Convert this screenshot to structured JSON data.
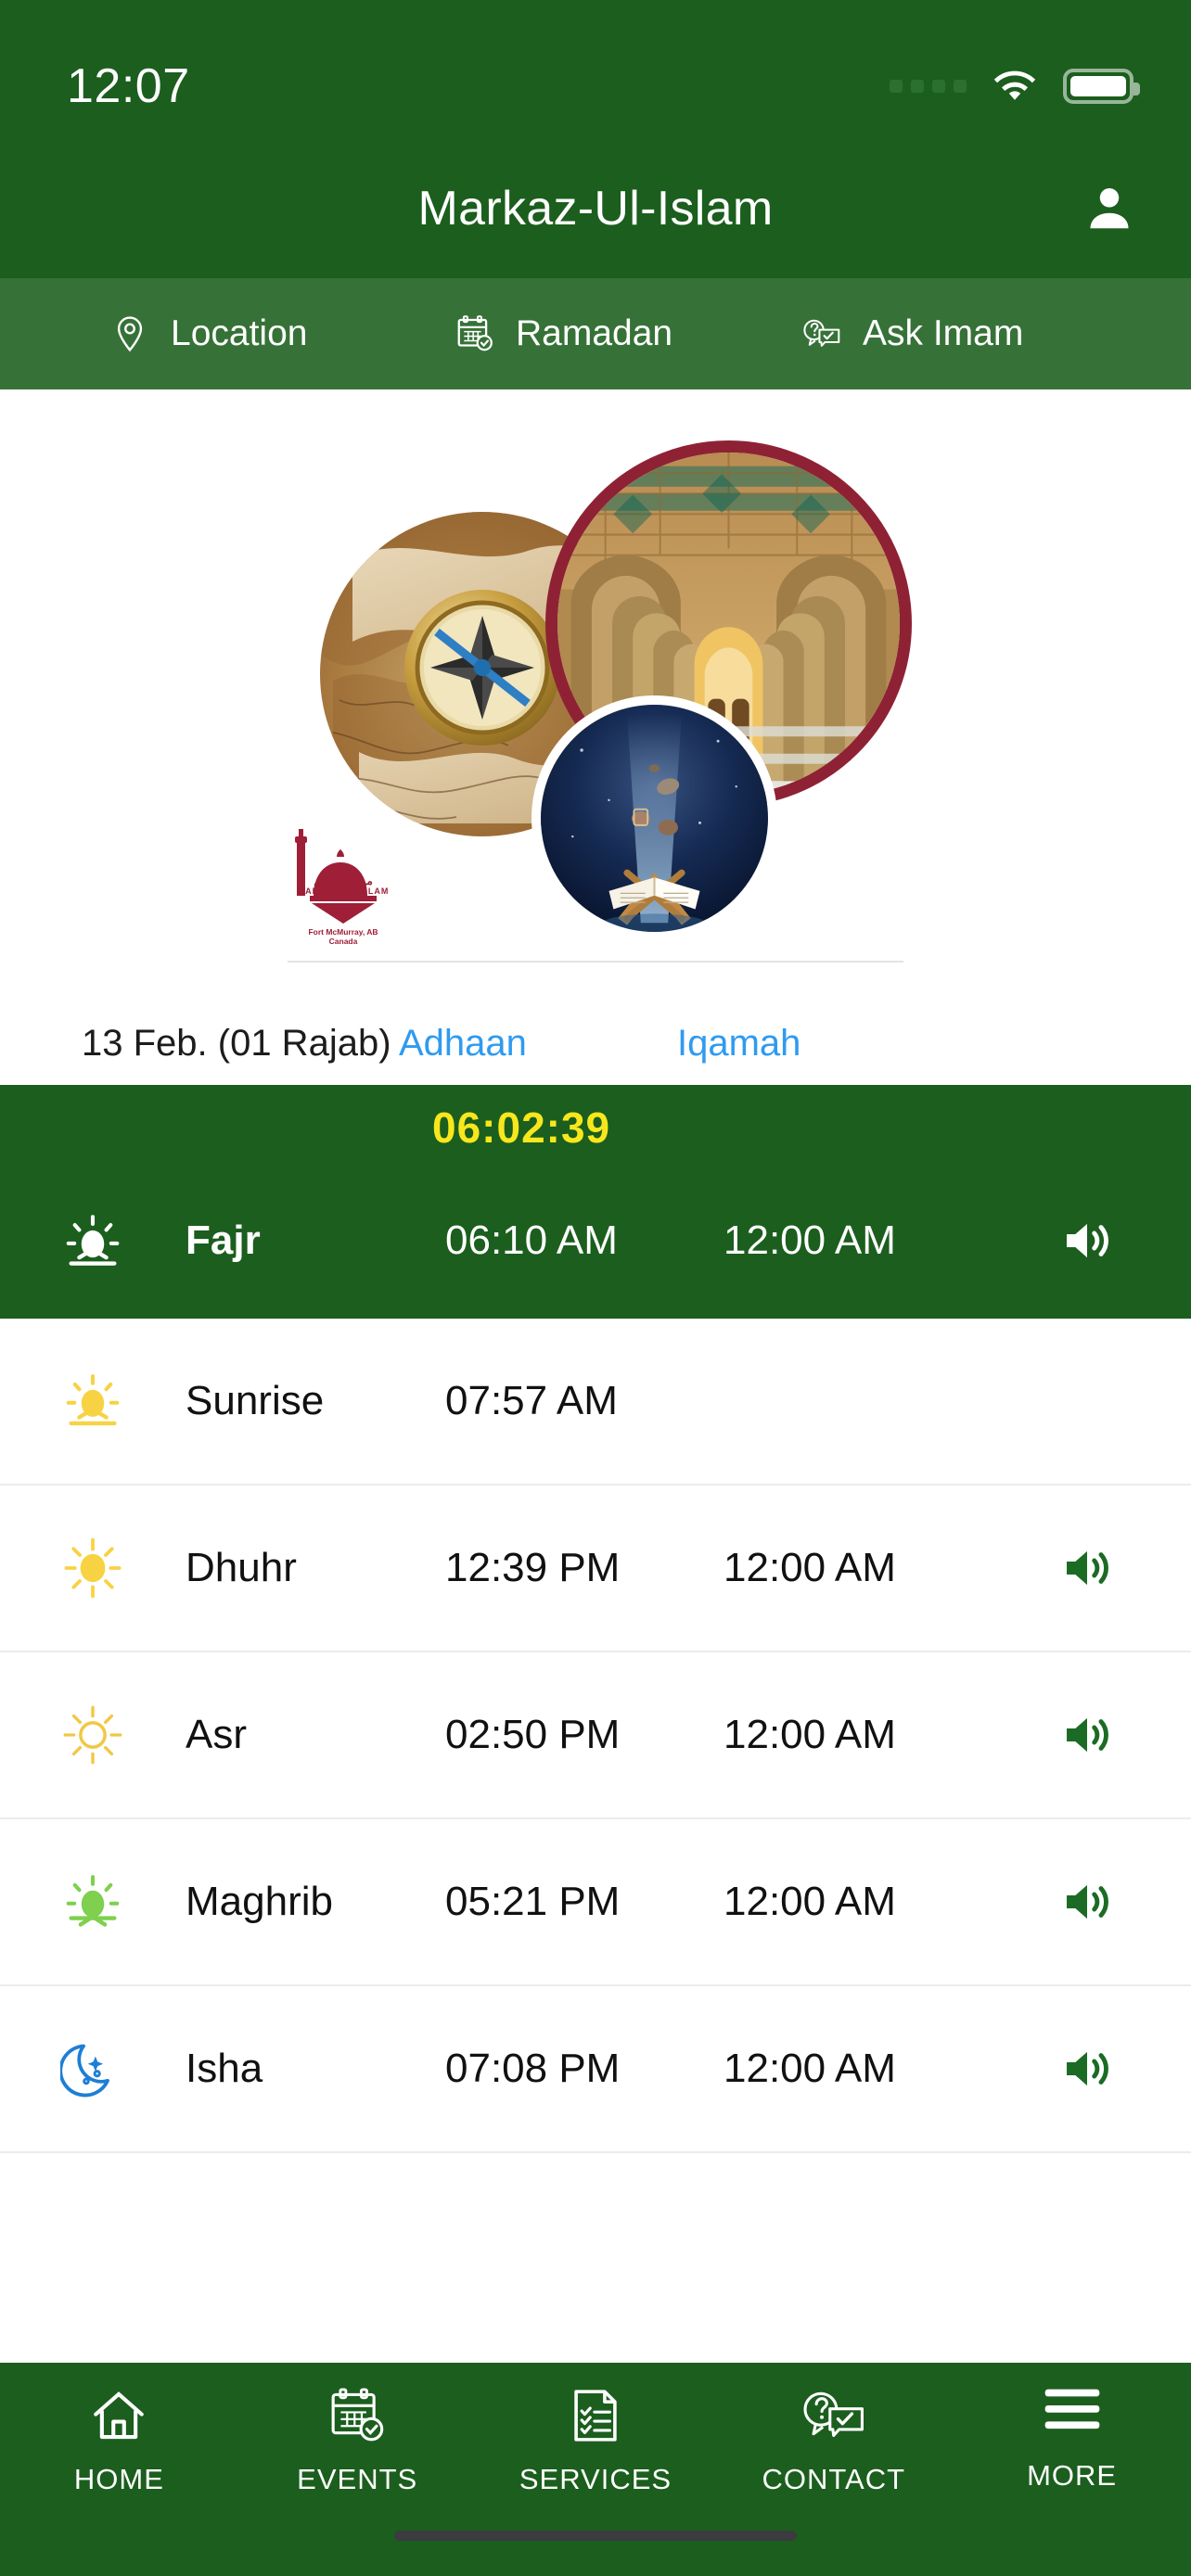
{
  "status_bar": {
    "time": "12:07",
    "signal_icon": "signal-dots-icon",
    "wifi_icon": "wifi-icon",
    "battery_icon": "battery-full-icon"
  },
  "header": {
    "title": "Markaz-Ul-Islam",
    "account_icon": "person-icon"
  },
  "subnav": {
    "items": [
      {
        "label": "Location",
        "icon": "location-pin-icon"
      },
      {
        "label": "Ramadan",
        "icon": "calendar-check-icon"
      },
      {
        "label": "Ask Imam",
        "icon": "question-chat-icon"
      }
    ]
  },
  "collage": {
    "logo_title": "MARKAZ UL ISLAM",
    "logo_subtitle": "Fort McMurray, AB\nCanada",
    "images": [
      {
        "name": "compass-on-map-image"
      },
      {
        "name": "mosque-arches-image"
      },
      {
        "name": "quran-night-sky-image"
      }
    ]
  },
  "columns": {
    "date": "13 Feb. (01 Rajab)",
    "adhaan": "Adhaan",
    "iqamah": "Iqamah"
  },
  "countdown": "06:02:39",
  "prayers": [
    {
      "name": "Fajr",
      "adhaan": "06:10 AM",
      "iqamah": "12:00 AM",
      "icon": "fajr-dawn-icon",
      "speaker": true,
      "highlight": true
    },
    {
      "name": "Sunrise",
      "adhaan": "07:57 AM",
      "iqamah": "",
      "icon": "sunrise-icon",
      "speaker": false,
      "highlight": false
    },
    {
      "name": "Dhuhr",
      "adhaan": "12:39 PM",
      "iqamah": "12:00 AM",
      "icon": "sun-filled-icon",
      "speaker": true,
      "highlight": false
    },
    {
      "name": "Asr",
      "adhaan": "02:50 PM",
      "iqamah": "12:00 AM",
      "icon": "sun-outline-icon",
      "speaker": true,
      "highlight": false
    },
    {
      "name": "Maghrib",
      "adhaan": "05:21 PM",
      "iqamah": "12:00 AM",
      "icon": "sunset-green-icon",
      "speaker": true,
      "highlight": false
    },
    {
      "name": "Isha",
      "adhaan": "07:08 PM",
      "iqamah": "12:00 AM",
      "icon": "moon-stars-icon",
      "speaker": true,
      "highlight": false
    }
  ],
  "bottom_nav": {
    "items": [
      {
        "label": "HOME",
        "icon": "home-icon"
      },
      {
        "label": "EVENTS",
        "icon": "calendar-check-icon"
      },
      {
        "label": "SERVICES",
        "icon": "checklist-document-icon"
      },
      {
        "label": "CONTACT",
        "icon": "question-chat-icon"
      },
      {
        "label": "MORE",
        "icon": "hamburger-menu-icon"
      }
    ]
  },
  "colors": {
    "header_green": "#1b5e1e",
    "subnav_green": "#367237",
    "link_blue": "#2e9bf0",
    "countdown_yellow": "#f8e71c",
    "speaker_green": "#1b6b24",
    "logo_maroon": "#9e1f37",
    "arch_border": "#8e2234"
  }
}
